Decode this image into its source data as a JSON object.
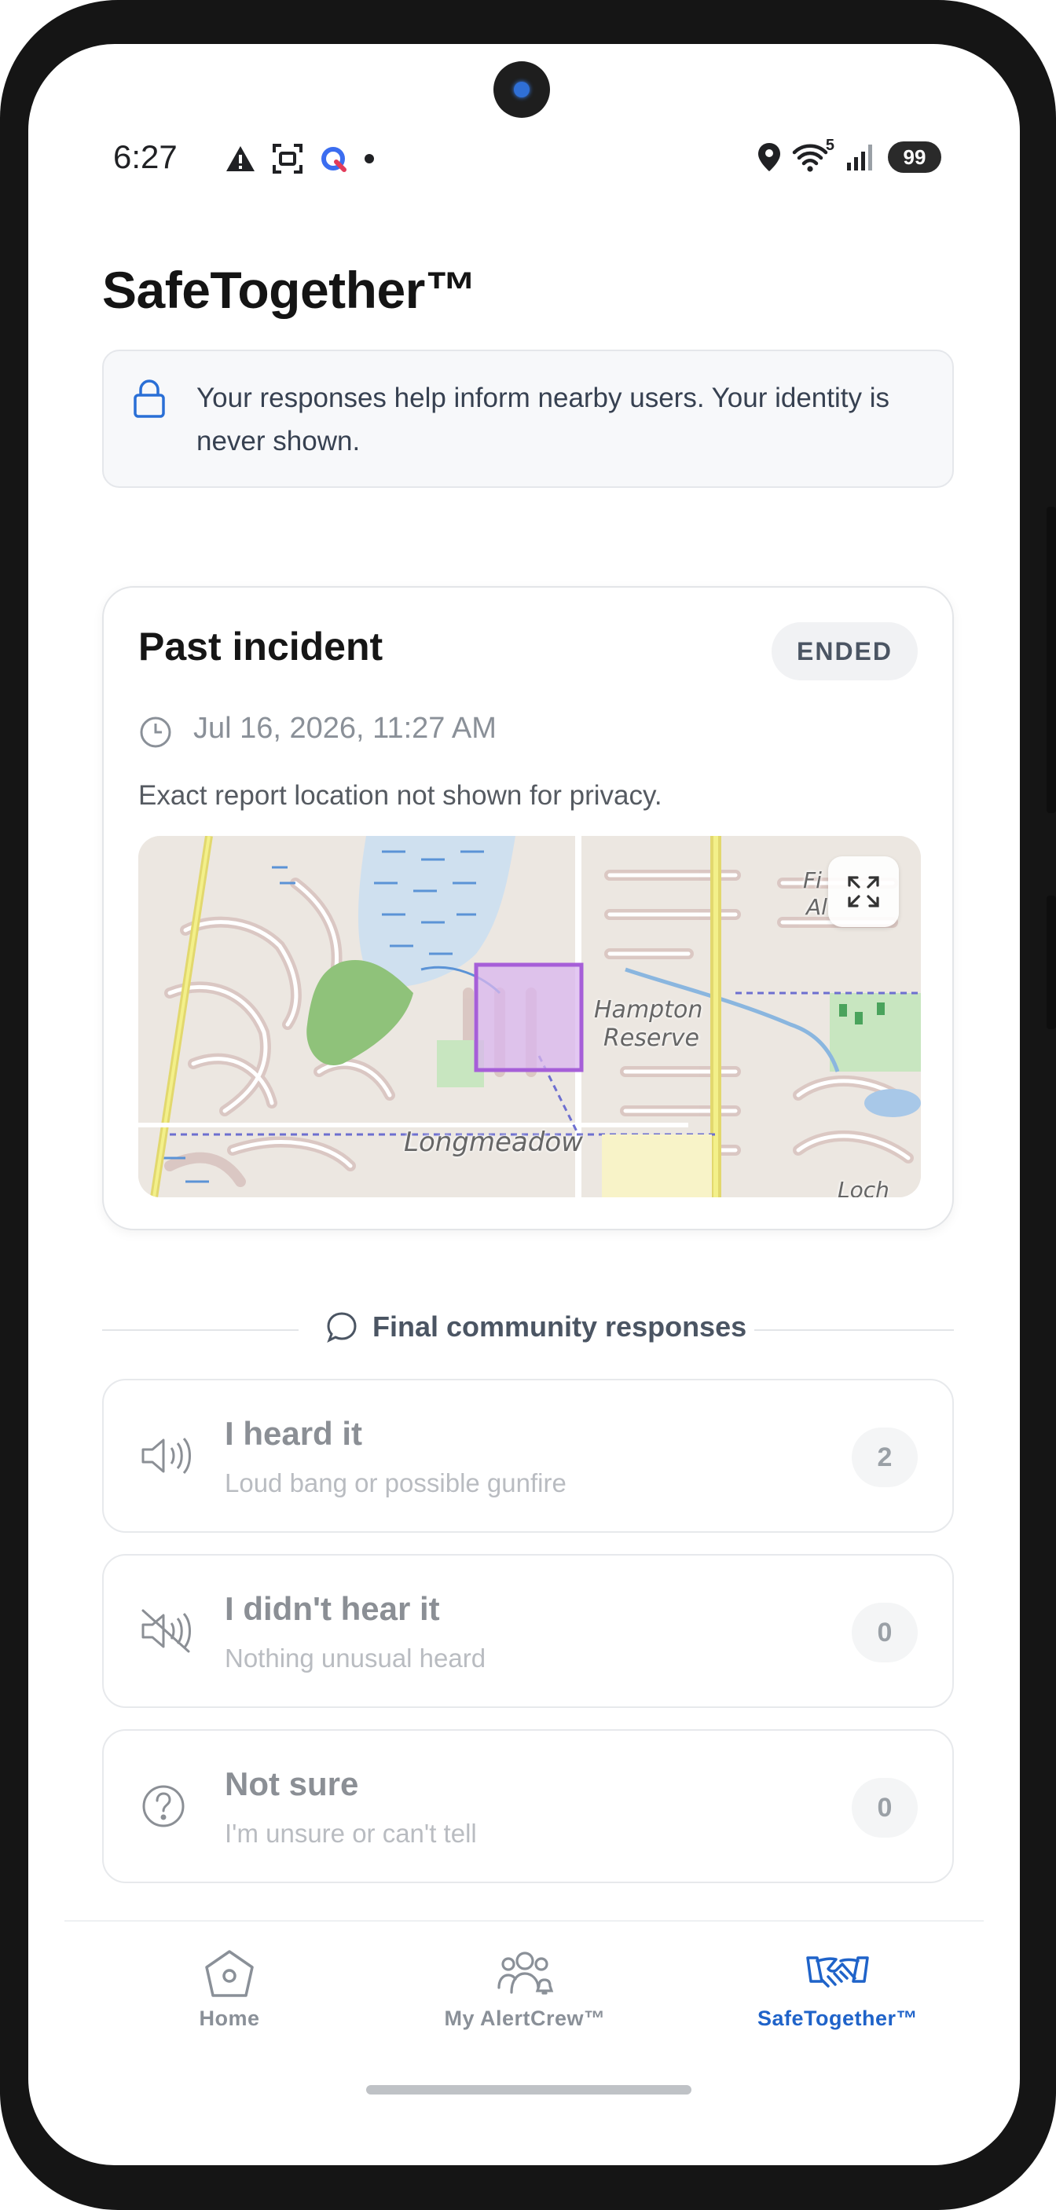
{
  "status_bar": {
    "time": "6:27",
    "wifi_badge": "5",
    "battery": "99",
    "left_icons": [
      "warning-icon",
      "screenshot-icon",
      "app-notification-icon",
      "dot-icon"
    ],
    "right_icons": [
      "location-icon",
      "wifi-icon",
      "signal-icon",
      "battery-icon"
    ]
  },
  "header": {
    "title": "SafeTogether™"
  },
  "privacy_banner": {
    "icon": "lock-icon",
    "text": "Your responses help inform nearby users. Your identity is never shown."
  },
  "incident": {
    "title": "Past incident",
    "status": "ENDED",
    "timestamp": "Jul 16, 2026, 11:27 AM",
    "location_note": "Exact report location not shown for privacy.",
    "map": {
      "labels": {
        "area1": "Hampton",
        "area2": "Reserve",
        "area3": "Longmeadow",
        "edge1": "Fi",
        "edge2": "Al",
        "edge3": "Loch"
      },
      "highlight_color": "#a65fd8"
    }
  },
  "responses": {
    "section_title": "Final community responses",
    "items": [
      {
        "title": "I heard it",
        "subtitle": "Loud bang or possible gunfire",
        "count": "2",
        "icon": "speaker-icon"
      },
      {
        "title": "I didn't hear it",
        "subtitle": "Nothing unusual heard",
        "count": "0",
        "icon": "speaker-muted-icon"
      },
      {
        "title": "Not sure",
        "subtitle": "I'm unsure or can't tell",
        "count": "0",
        "icon": "question-icon"
      }
    ]
  },
  "nav": {
    "active_color": "#1f63c9",
    "items": [
      {
        "label": "Home",
        "icon": "home-icon",
        "active": false
      },
      {
        "label": "My AlertCrew™",
        "icon": "group-icon",
        "active": false
      },
      {
        "label": "SafeTogether™",
        "icon": "handshake-icon",
        "active": true
      }
    ]
  }
}
